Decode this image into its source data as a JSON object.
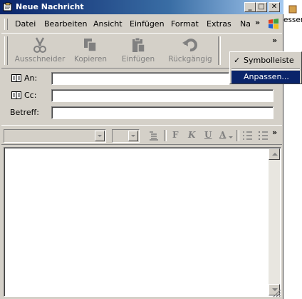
{
  "window": {
    "title": "Neue Nachricht"
  },
  "title_buttons": {
    "minimize": "_",
    "maximize": "□",
    "close": "✕"
  },
  "background": {
    "partial_text": "esser"
  },
  "menu": {
    "items": [
      "Datei",
      "Bearbeiten",
      "Ansicht",
      "Einfügen",
      "Format",
      "Extras",
      "Na"
    ],
    "overflow": "»"
  },
  "toolbar": {
    "items": [
      "Ausschneider",
      "Kopieren",
      "Einfügen",
      "Rückgängig"
    ],
    "overflow": "»"
  },
  "popup": {
    "items": [
      "Symbolleiste",
      "Anpassen..."
    ],
    "checked": "✓"
  },
  "fields": {
    "to_label": "An:",
    "cc_label": "Cc:",
    "subject_label": "Betreff:",
    "to_value": "",
    "cc_value": "",
    "subject_value": ""
  },
  "format_bar": {
    "font": "",
    "size": "",
    "bold": "F",
    "italic": "K",
    "underline": "U",
    "color": "A",
    "overflow": "»"
  },
  "colors": {
    "titlebar": "#0a246a",
    "selection": "#0a246a",
    "face": "#d4d0c8"
  }
}
